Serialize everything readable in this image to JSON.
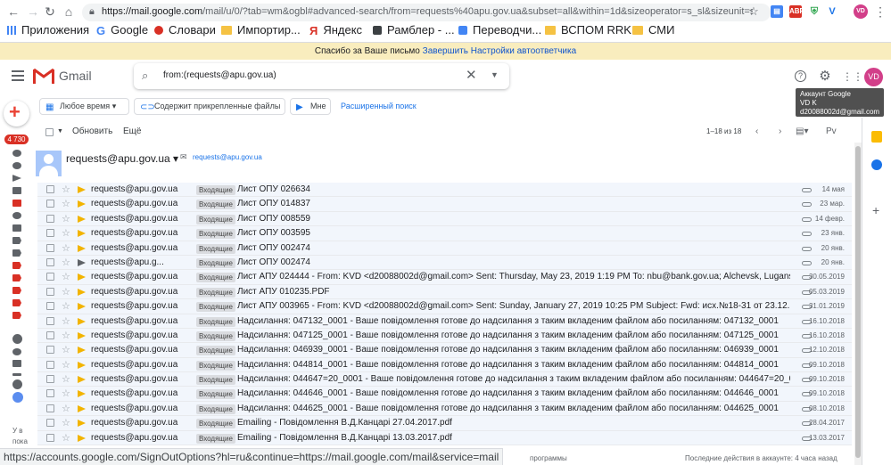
{
  "browser": {
    "url_host": "https://mail.google.com",
    "url_rest": "/mail/u/0/?tab=wm&ogbl#advanced-search/from=requests%40apu.gov.ua&subset=all&within=1d&sizeoperator=s_sl&sizeunit=s_smb&query=requ...",
    "bookmarks": [
      "Приложения",
      "Google",
      "Словари",
      "Импортир...",
      "Яндекс",
      "Рамблер - ...",
      "Переводчи...",
      "ВСПОМ RRK",
      "СМИ"
    ],
    "profile_initials": "VD"
  },
  "notice": {
    "text": "Спасибо за Ваше письмо",
    "link1": "Завершить",
    "link2": "Настройки автоответчика"
  },
  "gmail": {
    "logo_text": "Gmail",
    "search_value": "from:(requests@apu.gov.ua)",
    "avatar": "VD",
    "tooltip": {
      "line1": "Аккаунт Google",
      "line2": "VD K",
      "line3": "d20088002d@gmail.com"
    }
  },
  "chips": {
    "time": "Любое время",
    "attachments": "Содержит прикрепленные файлы",
    "to_me": "Мне",
    "advanced": "Расширенный поиск"
  },
  "rail": {
    "unread_count": "4 730",
    "bottom_line1": "У в",
    "bottom_line2": "пока"
  },
  "toolbar": {
    "refresh": "Обновить",
    "more": "Ещё",
    "pagination": "1–18 из 18",
    "lang": "Рv"
  },
  "contact": {
    "name": "requests@apu.gov.ua",
    "email": "requests@apu.gov.ua"
  },
  "label_inbox": "Входящие",
  "emails": [
    {
      "from": "requests@apu.gov.ua",
      "subject": "Лист ОПУ 026634",
      "date": "14 мая",
      "fwd": false
    },
    {
      "from": "requests@apu.gov.ua",
      "subject": "Лист ОПУ 014837",
      "date": "23 мар.",
      "fwd": false
    },
    {
      "from": "requests@apu.gov.ua",
      "subject": "Лист ОПУ 008559",
      "date": "14 февр.",
      "fwd": false
    },
    {
      "from": "requests@apu.gov.ua",
      "subject": "Лист ОПУ 003595",
      "date": "23 янв.",
      "fwd": false
    },
    {
      "from": "requests@apu.gov.ua",
      "subject": "Лист ОПУ 002474",
      "date": "20 янв.",
      "fwd": false
    },
    {
      "from": "requests@apu.g...",
      "subject": "Лист ОПУ 002474",
      "date": "20 янв.",
      "fwd": true
    },
    {
      "from": "requests@apu.gov.ua",
      "subject": "Лист АПУ 024444 - From: KVD <d20088002d@gmail.com> Sent: Thursday, May 23, 2019 1:19 PM To: nbu@bank.gov.ua; Alchevsk, Luganskoy <d...",
      "date": "30.05.2019",
      "fwd": false
    },
    {
      "from": "requests@apu.gov.ua",
      "subject": "Лист АПУ 010235.PDF",
      "date": "05.03.2019",
      "fwd": false
    },
    {
      "from": "requests@apu.gov.ua",
      "subject": "Лист АПУ 003965 - From: KVD <d20088002d@gmail.com> Sent: Sunday, January 27, 2019 10:25 PM Subject: Fwd: исх.№18-31 от 23.12.2018г., ...",
      "date": "31.01.2019",
      "fwd": false
    },
    {
      "from": "requests@apu.gov.ua",
      "subject": "Надсилання: 047132_0001 - Ваше повідомлення готове до надсилання з таким вкладеним файлом або посиланням: 047132_0001",
      "date": "16.10.2018",
      "fwd": false
    },
    {
      "from": "requests@apu.gov.ua",
      "subject": "Надсилання: 047125_0001 - Ваше повідомлення готове до надсилання з таким вкладеним файлом або посиланням: 047125_0001",
      "date": "16.10.2018",
      "fwd": false
    },
    {
      "from": "requests@apu.gov.ua",
      "subject": "Надсилання: 046939_0001 - Ваше повідомлення готове до надсилання з таким вкладеним файлом або посиланням: 046939_0001",
      "date": "12.10.2018",
      "fwd": false
    },
    {
      "from": "requests@apu.gov.ua",
      "subject": "Надсилання: 044814_0001 - Ваше повідомлення готове до надсилання з таким вкладеним файлом або посиланням: 044814_0001",
      "date": "09.10.2018",
      "fwd": false
    },
    {
      "from": "requests@apu.gov.ua",
      "subject": "Надсилання: 044647=20_0001 - Ваше повідомлення готове до надсилання з таким вкладеним файлом або посиланням: 044647=20_0001",
      "date": "09.10.2018",
      "fwd": false
    },
    {
      "from": "requests@apu.gov.ua",
      "subject": "Надсилання: 044646_0001 - Ваше повідомлення готове до надсилання з таким вкладеним файлом або посиланням: 044646_0001",
      "date": "09.10.2018",
      "fwd": false
    },
    {
      "from": "requests@apu.gov.ua",
      "subject": "Надсилання: 044625_0001 - Ваше повідомлення готове до надсилання з таким вкладеним файлом або посиланням: 044625_0001",
      "date": "08.10.2018",
      "fwd": false
    },
    {
      "from": "requests@apu.gov.ua",
      "subject": "Emailing - Повідомлення В.Д.Канцарі 27.04.2017.pdf",
      "date": "28.04.2017",
      "fwd": false
    },
    {
      "from": "requests@apu.gov.ua",
      "subject": "Emailing - Повідомлення В.Д.Канцарі 13.03.2017.pdf",
      "date": "13.03.2017",
      "fwd": false
    }
  ],
  "status_url": "https://accounts.google.com/SignOutOptions?hl=ru&continue=https://mail.google.com/mail&service=mail",
  "footer": {
    "programs": "программы",
    "last_activity": "Последние действия в аккаунте: 4 часа назад"
  },
  "colors": {
    "accent": "#1a73e8",
    "notice_bg": "#f9edbe",
    "important": "#f2b400",
    "badge": "#d93025",
    "avatar": "#d23f89"
  }
}
